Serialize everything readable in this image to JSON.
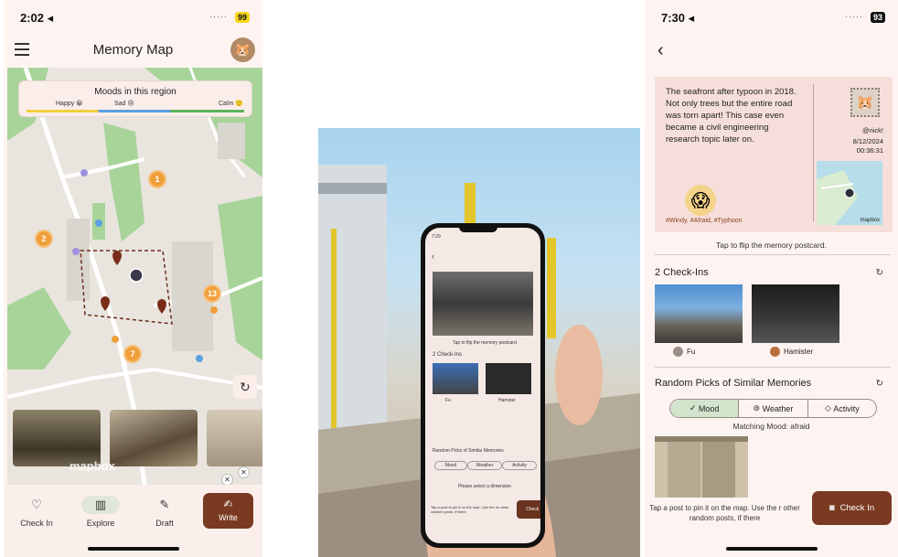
{
  "screen1": {
    "status": {
      "time": "2:02 ◂",
      "battery": "99"
    },
    "title": "Memory Map",
    "mood_legend": {
      "title": "Moods in this region",
      "happy": "Happy 😀",
      "sad": "Sad 😢",
      "calm": "Calm 🙂"
    },
    "clusters": [
      "1",
      "2",
      "13",
      "7"
    ],
    "mapbox": "mapbox",
    "nav": {
      "checkin": "Check In",
      "explore": "Explore",
      "draft": "Draft",
      "write": "Write"
    }
  },
  "phone_in_photo": {
    "time": "7:29",
    "hint": "Tap to flip the memory postcard.",
    "checkins_title": "2 Check-Ins",
    "user1": "Fu",
    "user2": "Hamster",
    "random_title": "Random Picks of Similar Memories",
    "seg_mood": "Mood",
    "seg_weather": "Weather",
    "seg_activity": "Activity",
    "select_hint": "Please select a dimension",
    "bottom_hint": "Tap a post to pin it on the map. Use the no other random posts, if there",
    "checkin": "Check In"
  },
  "screen3": {
    "status": {
      "time": "7:30 ◂",
      "battery": "93"
    },
    "postcard": {
      "body": "The seafront after typoon in 2018. Not only trees but the entire road was torn apart! This case even became a civil engineering research topic later on.",
      "user": "@nick!",
      "date": "8/12/2024",
      "time": "00:36:31",
      "tags": "#Windy, #Afraid, #Typhoon",
      "mapbox": "mapbox"
    },
    "flip_hint": "Tap to flip the memory postcard.",
    "checkins_title": "2 Check-Ins",
    "checkin_users": [
      "Fu",
      "Hamister"
    ],
    "random_title": "Random Picks of Similar Memories",
    "segments": {
      "mood": "Mood",
      "weather": "Weather",
      "activity": "Activity"
    },
    "matching": "Matching Mood: afraid",
    "bottom_hint": "Tap a post to pin it on the map. Use the r other random posts, if there",
    "checkin_button": "Check In"
  }
}
